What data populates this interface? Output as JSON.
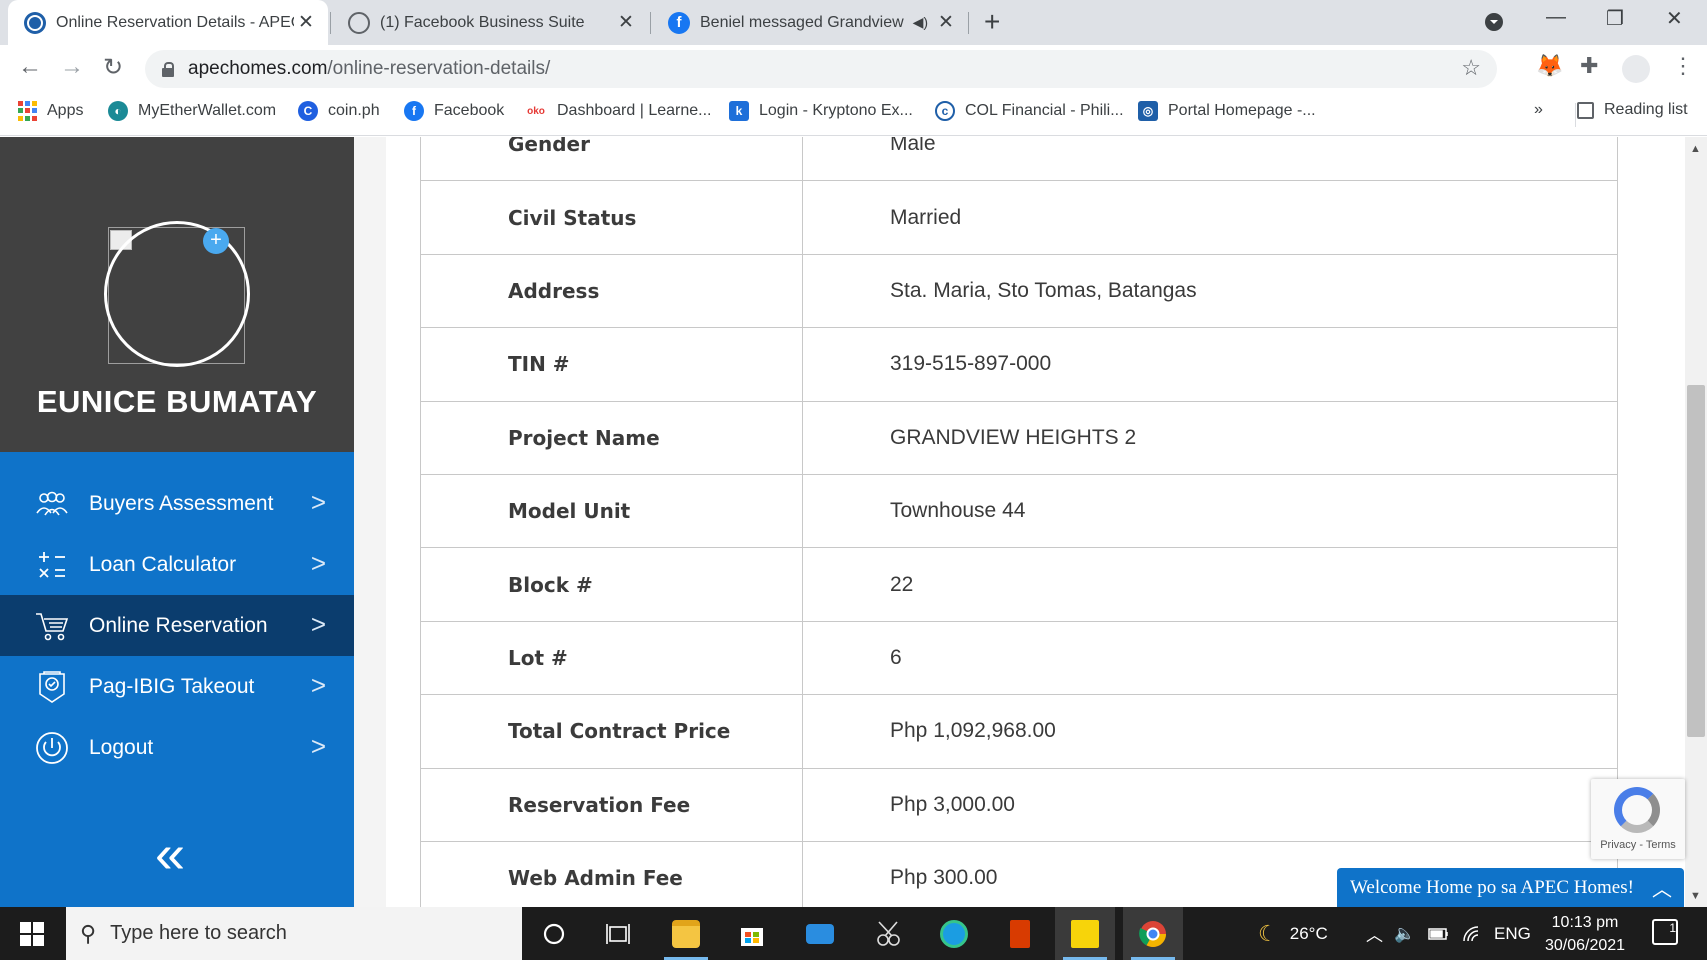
{
  "browser": {
    "tabs": [
      {
        "title": "Online Reservation Details - APEC",
        "close": "✕"
      },
      {
        "title": "(1) Facebook Business Suite",
        "close": "✕"
      },
      {
        "title": "Beniel messaged Grandview",
        "close": "✕"
      }
    ],
    "new_tab": "+",
    "url_host": "apechomes.com",
    "url_path": "/online-reservation-details/",
    "bookmarks": [
      {
        "label": "Apps"
      },
      {
        "label": "MyEtherWallet.com"
      },
      {
        "label": "coin.ph"
      },
      {
        "label": "Facebook"
      },
      {
        "label": "Dashboard | Learne..."
      },
      {
        "label": "Login - Kryptono Ex..."
      },
      {
        "label": "COL Financial - Phili..."
      },
      {
        "label": "Portal Homepage -..."
      }
    ],
    "more_bookmarks": "»",
    "reading_list": "Reading list"
  },
  "sidebar": {
    "user_name": "EUNICE BUMATAY",
    "menu": [
      {
        "label": "Buyers Assessment",
        "icon": "users-icon"
      },
      {
        "label": "Loan Calculator",
        "icon": "calculator-icon"
      },
      {
        "label": "Online Reservation",
        "icon": "cart-icon"
      },
      {
        "label": "Pag-IBIG Takeout",
        "icon": "certificate-icon"
      },
      {
        "label": "Logout",
        "icon": "power-icon"
      }
    ],
    "collapse_label": "«"
  },
  "details": [
    {
      "label": "Gender",
      "value": "Male"
    },
    {
      "label": "Civil Status",
      "value": "Married"
    },
    {
      "label": "Address",
      "value": "Sta. Maria, Sto Tomas, Batangas"
    },
    {
      "label": "TIN #",
      "value": "319-515-897-000"
    },
    {
      "label": "Project Name",
      "value": "GRANDVIEW HEIGHTS 2"
    },
    {
      "label": "Model Unit",
      "value": "Townhouse 44"
    },
    {
      "label": "Block #",
      "value": "22"
    },
    {
      "label": "Lot #",
      "value": "6"
    },
    {
      "label": "Total Contract Price",
      "value": "Php 1,092,968.00"
    },
    {
      "label": "Reservation Fee",
      "value": "Php 3,000.00"
    },
    {
      "label": "Web Admin Fee",
      "value": "Php 300.00"
    }
  ],
  "recaptcha": {
    "links": "Privacy - Terms"
  },
  "chat": {
    "text": "Welcome Home po sa APEC Homes!"
  },
  "taskbar": {
    "search_placeholder": "Type here to search",
    "temperature": "26°C",
    "language": "ENG",
    "time": "10:13 pm",
    "date": "30/06/2021",
    "notifications": "1"
  },
  "colors": {
    "sidebar": "#0f73c9",
    "sidebar_active": "#0b3d6e",
    "sidebar_header": "#414141"
  }
}
